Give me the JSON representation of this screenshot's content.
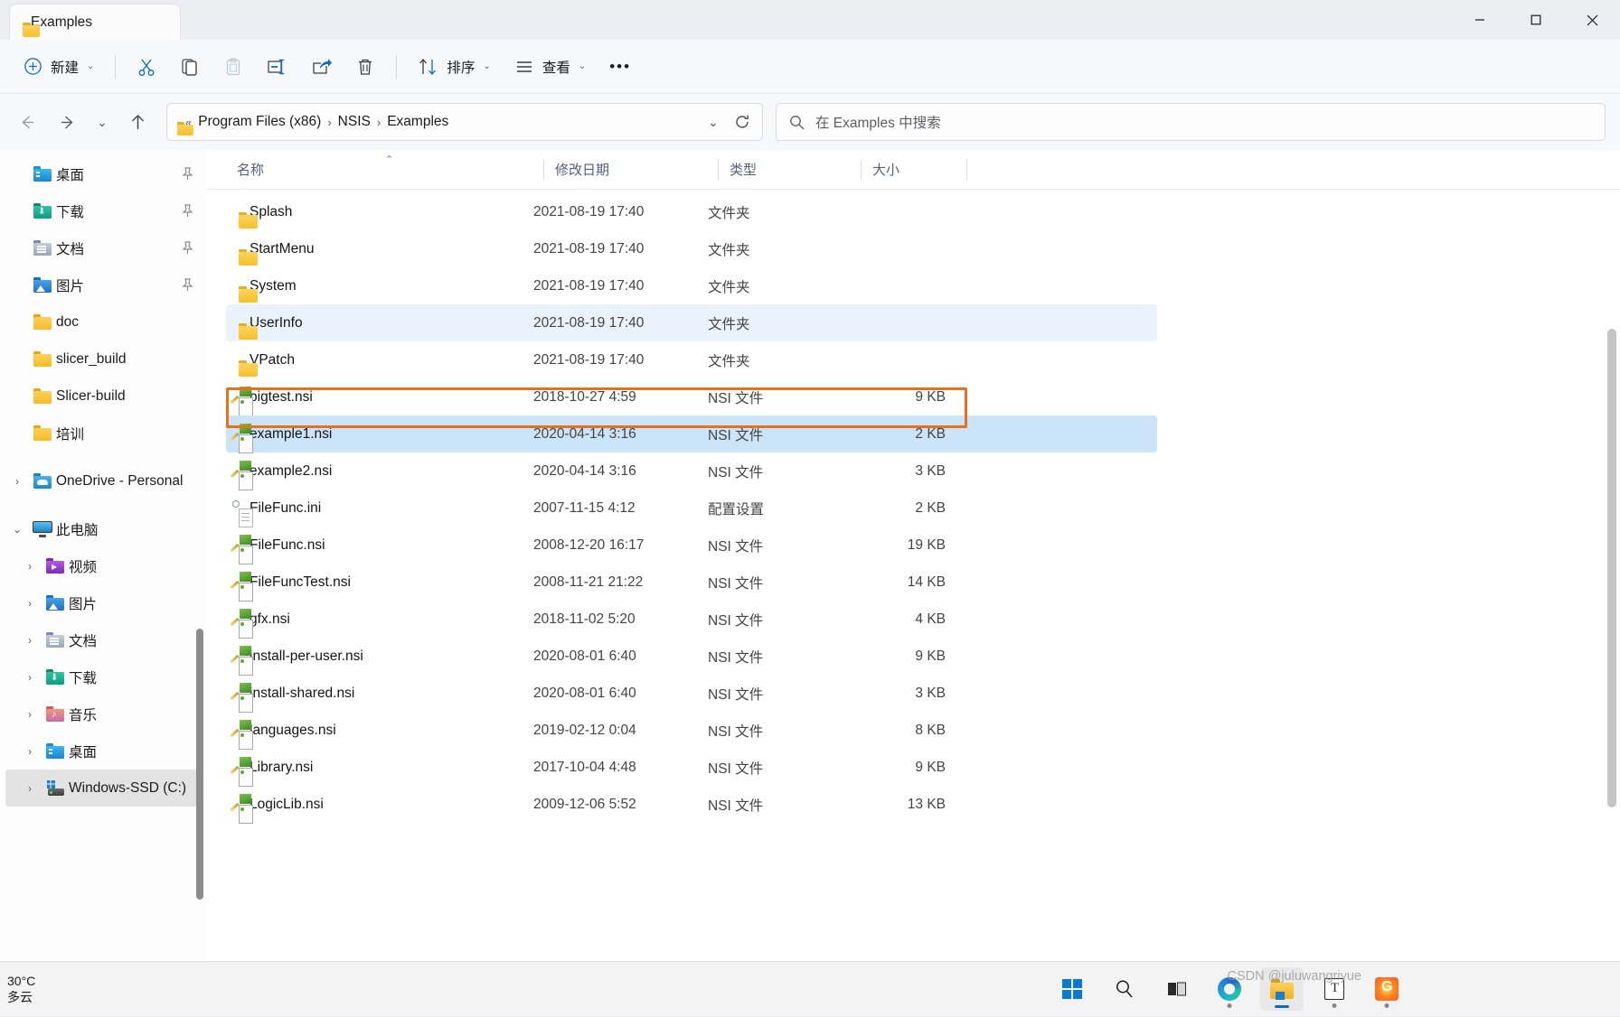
{
  "window": {
    "tab_title": "Examples",
    "controls": {
      "minimize": "─",
      "maximize": "□",
      "close": "✕"
    }
  },
  "toolbar": {
    "new_label": "新建",
    "cut_label": "剪切",
    "copy_label": "复制",
    "paste_label": "粘贴",
    "rename_label": "重命名",
    "share_label": "共享",
    "delete_label": "删除",
    "sort_label": "排序",
    "view_label": "查看",
    "more_label": "•••"
  },
  "address": {
    "back": "←",
    "forward": "→",
    "recent": "ˇ",
    "up": "↑",
    "prefix": "«",
    "crumbs": [
      "Program Files (x86)",
      "NSIS",
      "Examples"
    ],
    "separator": "›",
    "dropdown": "ˇ",
    "refresh": "↻"
  },
  "search": {
    "placeholder": "在 Examples 中搜索"
  },
  "sidebar": {
    "quick_items": [
      {
        "label": "桌面",
        "icon": "desktop-icon",
        "pinned": true
      },
      {
        "label": "下载",
        "icon": "downloads-icon",
        "pinned": true
      },
      {
        "label": "文档",
        "icon": "documents-icon",
        "pinned": true
      },
      {
        "label": "图片",
        "icon": "pictures-icon",
        "pinned": true
      },
      {
        "label": "doc",
        "icon": "folder-icon",
        "pinned": false
      },
      {
        "label": "slicer_build",
        "icon": "folder-icon",
        "pinned": false
      },
      {
        "label": "Slicer-build",
        "icon": "folder-icon",
        "pinned": false
      },
      {
        "label": "培训",
        "icon": "folder-icon",
        "pinned": false
      }
    ],
    "onedrive": {
      "label": "OneDrive - Personal",
      "icon": "onedrive-icon",
      "expanded": false
    },
    "this_pc": {
      "label": "此电脑",
      "icon": "this-pc-icon",
      "expanded": true
    },
    "pc_children": [
      {
        "label": "视频",
        "icon": "videos-icon"
      },
      {
        "label": "图片",
        "icon": "pictures-icon"
      },
      {
        "label": "文档",
        "icon": "documents-icon"
      },
      {
        "label": "下载",
        "icon": "downloads-icon"
      },
      {
        "label": "音乐",
        "icon": "music-icon"
      },
      {
        "label": "桌面",
        "icon": "desktop-icon"
      },
      {
        "label": "Windows-SSD (C:)",
        "icon": "drive-icon",
        "selected": true
      }
    ],
    "expand_collapsed": "›",
    "expand_open": "⌄",
    "pin_glyph": "ᴗ"
  },
  "columns": [
    {
      "key": "name",
      "label": "名称",
      "sorted": true,
      "sort_dir": "asc"
    },
    {
      "key": "date",
      "label": "修改日期"
    },
    {
      "key": "type",
      "label": "类型"
    },
    {
      "key": "size",
      "label": "大小"
    }
  ],
  "sort_caret": "⌃",
  "files": [
    {
      "name": "Splash",
      "date": "2021-08-19 17:40",
      "type": "文件夹",
      "size": "",
      "icon": "folder-icon",
      "state": ""
    },
    {
      "name": "StartMenu",
      "date": "2021-08-19 17:40",
      "type": "文件夹",
      "size": "",
      "icon": "folder-icon",
      "state": ""
    },
    {
      "name": "System",
      "date": "2021-08-19 17:40",
      "type": "文件夹",
      "size": "",
      "icon": "folder-icon",
      "state": ""
    },
    {
      "name": "UserInfo",
      "date": "2021-08-19 17:40",
      "type": "文件夹",
      "size": "",
      "icon": "folder-icon",
      "state": "hovered"
    },
    {
      "name": "VPatch",
      "date": "2021-08-19 17:40",
      "type": "文件夹",
      "size": "",
      "icon": "folder-icon",
      "state": ""
    },
    {
      "name": "bigtest.nsi",
      "date": "2018-10-27 4:59",
      "type": "NSI 文件",
      "size": "9 KB",
      "icon": "nsi-file-icon",
      "state": ""
    },
    {
      "name": "example1.nsi",
      "date": "2020-04-14 3:16",
      "type": "NSI 文件",
      "size": "2 KB",
      "icon": "nsi-file-icon",
      "state": "selected"
    },
    {
      "name": "example2.nsi",
      "date": "2020-04-14 3:16",
      "type": "NSI 文件",
      "size": "3 KB",
      "icon": "nsi-file-icon",
      "state": ""
    },
    {
      "name": "FileFunc.ini",
      "date": "2007-11-15 4:12",
      "type": "配置设置",
      "size": "2 KB",
      "icon": "ini-file-icon",
      "state": ""
    },
    {
      "name": "FileFunc.nsi",
      "date": "2008-12-20 16:17",
      "type": "NSI 文件",
      "size": "19 KB",
      "icon": "nsi-file-icon",
      "state": ""
    },
    {
      "name": "FileFuncTest.nsi",
      "date": "2008-11-21 21:22",
      "type": "NSI 文件",
      "size": "14 KB",
      "icon": "nsi-file-icon",
      "state": ""
    },
    {
      "name": "gfx.nsi",
      "date": "2018-11-02 5:20",
      "type": "NSI 文件",
      "size": "4 KB",
      "icon": "nsi-file-icon",
      "state": ""
    },
    {
      "name": "install-per-user.nsi",
      "date": "2020-08-01 6:40",
      "type": "NSI 文件",
      "size": "9 KB",
      "icon": "nsi-file-icon",
      "state": ""
    },
    {
      "name": "install-shared.nsi",
      "date": "2020-08-01 6:40",
      "type": "NSI 文件",
      "size": "3 KB",
      "icon": "nsi-file-icon",
      "state": ""
    },
    {
      "name": "languages.nsi",
      "date": "2019-02-12 0:04",
      "type": "NSI 文件",
      "size": "8 KB",
      "icon": "nsi-file-icon",
      "state": ""
    },
    {
      "name": "Library.nsi",
      "date": "2017-10-04 4:48",
      "type": "NSI 文件",
      "size": "9 KB",
      "icon": "nsi-file-icon",
      "state": ""
    },
    {
      "name": "LogicLib.nsi",
      "date": "2009-12-06 5:52",
      "type": "NSI 文件",
      "size": "13 KB",
      "icon": "nsi-file-icon",
      "state": ""
    }
  ],
  "annotation": {
    "color": "#e8701a",
    "target": "example1.nsi"
  },
  "taskbar": {
    "weather_temp": "30°C",
    "weather_desc": "多云",
    "items": [
      {
        "name": "start-button",
        "icon": "windows-logo-icon"
      },
      {
        "name": "search-taskbar",
        "icon": "search-icon"
      },
      {
        "name": "task-view",
        "icon": "task-view-icon"
      },
      {
        "name": "edge-browser",
        "icon": "edge-icon"
      },
      {
        "name": "file-explorer",
        "icon": "file-explorer-icon",
        "active": true
      },
      {
        "name": "text-app",
        "icon": "text-editor-icon"
      },
      {
        "name": "orange-app",
        "icon": "orange-app-icon"
      }
    ]
  },
  "watermark": "CSDN @juluwangriyue"
}
